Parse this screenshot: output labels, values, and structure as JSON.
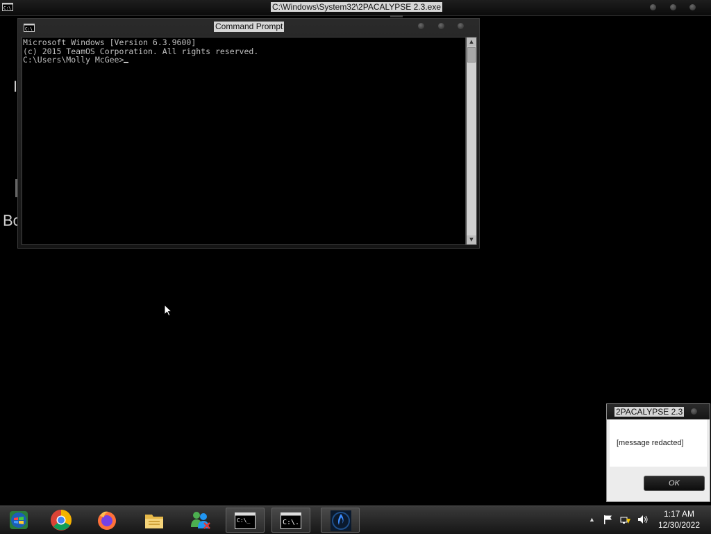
{
  "topbar": {
    "title": "C:\\Windows\\System32\\2PACALYPSE 2.3.exe",
    "icon": "cmd-icon"
  },
  "background": {
    "partial_text_1": "I",
    "partial_text_2": "Bo"
  },
  "cmd_window": {
    "title": "Command Prompt",
    "lines": [
      "Microsoft Windows [Version 6.3.9600]",
      "(c) 2015 TeamOS Corporation. All rights reserved.",
      "",
      "C:\\Users\\Molly McGee>"
    ]
  },
  "message_box": {
    "title": "2PACALYPSE 2.3",
    "message": "[message redacted]",
    "ok_label": "OK"
  },
  "taskbar": {
    "items": [
      "start-orb-icon",
      "chrome-icon",
      "firefox-icon",
      "file-explorer-icon",
      "windows-live-messenger-icon",
      "command-prompt-icon",
      "command-prompt-icon",
      "2pacalypse-flame-icon"
    ],
    "clock": {
      "time": "1:17 AM",
      "date": "12/30/2022"
    }
  },
  "colors": {
    "desktop_background": "#000000",
    "console_text": "#c0c0c0"
  }
}
